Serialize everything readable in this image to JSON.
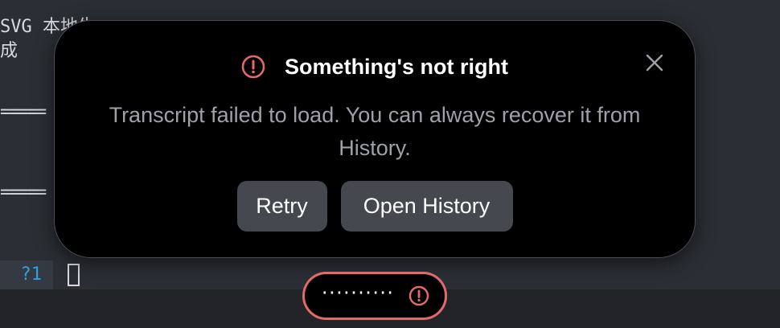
{
  "terminal": {
    "line1": "SVG 本地生",
    "line2": "成",
    "separator1": "=====",
    "separator2": "=====",
    "gutter_label": "?1"
  },
  "dialog": {
    "title": "Something's not right",
    "message": "Transcript failed to load. You can always recover it from History.",
    "retry_label": "Retry",
    "open_history_label": "Open History",
    "icons": {
      "alert": "alert-circle-icon",
      "close": "close-icon"
    }
  },
  "status_pill": {
    "dots": "··········",
    "icon": "alert-circle-icon"
  },
  "colors": {
    "alert": "#e36a6a",
    "dialog_bg": "#000000",
    "button_bg": "#45484f",
    "gutter_text": "#2fa0e6"
  }
}
